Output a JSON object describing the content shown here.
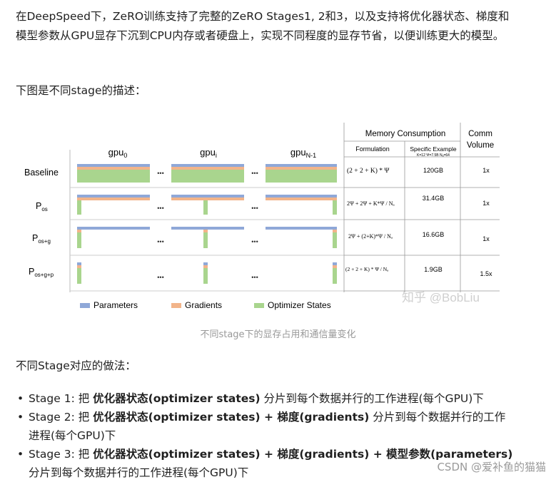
{
  "article": {
    "intro": "在DeepSpeed下，ZeRO训练支持了完整的ZeRO Stages1, 2和3，以及支持将优化器状态、梯度和模型参数从GPU显存下沉到CPU内存或者硬盘上，实现不同程度的显存节省，以便训练更大的模型。",
    "figure_intro": "下图是不同stage的描述：",
    "caption": "不同stage下的显存占用和通信量变化",
    "stage_intro": "不同Stage对应的做法：",
    "bullets": [
      {
        "prefix": "Stage 1: 把 ",
        "b1": "优化器状态(optimizer states)",
        "rest": " 分片到每个数据并行的工作进程(每个GPU)下"
      },
      {
        "prefix": "Stage 2: 把 ",
        "b1": "优化器状态(optimizer states) + 梯度(gradients)",
        "rest": " 分片到每个数据并行的工作进程(每个GPU)下"
      },
      {
        "prefix": "Stage 3: 把 ",
        "b1": "优化器状态(optimizer states) + 梯度(gradients) + 模型参数(parameters)",
        "rest": " 分片到每个数据并行的工作进程(每个GPU)下"
      }
    ],
    "watermark": "CSDN @爱补鱼的猫猫"
  },
  "figure": {
    "gpu_headers": [
      {
        "base": "gpu",
        "sub": "0"
      },
      {
        "base": "gpu",
        "sub": "i"
      },
      {
        "base": "gpu",
        "sub": "N-1"
      }
    ],
    "ellipsis": "•••",
    "table_header": {
      "memory": "Memory Consumption",
      "comm_line1": "Comm",
      "comm_line2": "Volume",
      "formulation": "Formulation",
      "specific": "Specific Example",
      "specific_sub": "K=12 Ψ=7.5B Nₐ=64"
    },
    "rows": [
      {
        "label": "Baseline",
        "sub": "",
        "formula": "(2 + 2 + K) * Ψ",
        "memory": "120GB",
        "comm": "1x"
      },
      {
        "label": "P",
        "sub": "os",
        "formula": "2Ψ + 2Ψ + K*Ψ / Nₐ",
        "memory": "31.4GB",
        "comm": "1x"
      },
      {
        "label": "P",
        "sub": "os+g",
        "formula": "2Ψ + (2+K)*Ψ / Nₐ",
        "memory": "16.6GB",
        "comm": "1x"
      },
      {
        "label": "P",
        "sub": "os+g+p",
        "formula": "(2 + 2 + K) * Ψ / Nₐ",
        "memory": "1.9GB",
        "comm": "1.5x"
      }
    ],
    "legend": [
      "Parameters",
      "Gradients",
      "Optimizer States"
    ],
    "zhihu_watermark": "知乎 @BobLiu",
    "colors": {
      "parameters": "#8fa8d8",
      "gradients": "#f2b48a",
      "optimizer": "#a9d58e"
    }
  }
}
